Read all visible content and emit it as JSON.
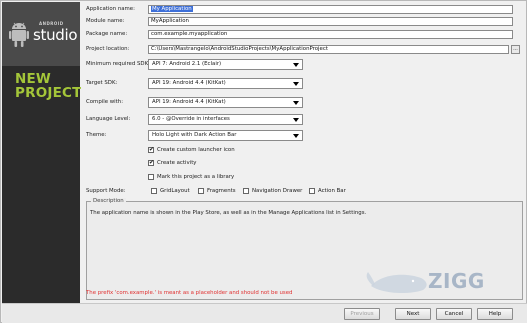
{
  "sidebar": {
    "brand_small": "ANDROID",
    "brand": "studio",
    "heading_line1": "NEW",
    "heading_line2": "PROJECT"
  },
  "form": {
    "app_name": {
      "label": "Application name:",
      "value": "My Application"
    },
    "module_name": {
      "label": "Module name:",
      "value": "MyApplication"
    },
    "package_name": {
      "label": "Package name:",
      "value": "com.example.myapplication"
    },
    "project_location": {
      "label": "Project location:",
      "value": "C:\\Users\\Mastrangelo\\AndroidStudioProjects\\MyApplicationProject",
      "browse": "..."
    },
    "min_sdk": {
      "label": "Minimum required SDK:",
      "value": "API 7: Android 2.1 (Eclair)"
    },
    "target_sdk": {
      "label": "Target SDK:",
      "value": "API 19: Android 4.4 (KitKat)"
    },
    "compile_with": {
      "label": "Compile with:",
      "value": "API 19: Android 4.4 (KitKat)"
    },
    "language_level": {
      "label": "Language Level:",
      "value": "6.0 - @Override in interfaces"
    },
    "theme": {
      "label": "Theme:",
      "value": "Holo Light with Dark Action Bar"
    },
    "checkboxes": [
      {
        "label": "Create custom launcher icon",
        "checked": true
      },
      {
        "label": "Create activity",
        "checked": true
      },
      {
        "label": "Mark this project as a library",
        "checked": false
      }
    ],
    "support_mode": {
      "label": "Support Mode:",
      "options": [
        {
          "label": "GridLayout",
          "checked": false
        },
        {
          "label": "Fragments",
          "checked": false
        },
        {
          "label": "Navigation Drawer",
          "checked": false
        },
        {
          "label": "Action Bar",
          "checked": false
        }
      ]
    }
  },
  "description": {
    "title": "Description",
    "text": "The application name is shown in the Play Store, as well as in the Manage Applications list in Settings."
  },
  "warning": "The prefix 'com.example.' is meant as a placeholder and should not be used",
  "watermark": "ZIGG",
  "buttons": {
    "previous": "Previous",
    "next": "Next",
    "cancel": "Cancel",
    "help": "Help"
  },
  "colors": {
    "sidebar_bg": "#2b2b2b",
    "heading_green": "#a4c639",
    "selection_blue": "#3d6fd8",
    "warning_red": "#e03030"
  }
}
